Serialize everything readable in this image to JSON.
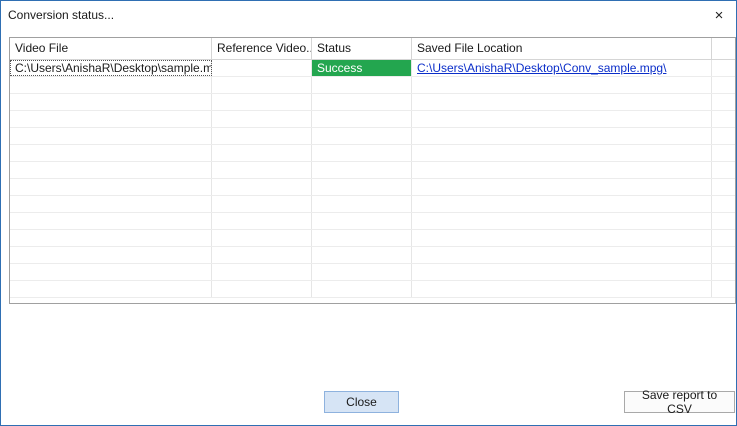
{
  "window": {
    "title": "Conversion status...",
    "close_glyph": "×"
  },
  "table": {
    "columns": [
      "Video File",
      "Reference Video...",
      "Status",
      "Saved File Location"
    ],
    "rows": [
      {
        "video_file": "C:\\Users\\AnishaR\\Desktop\\sample.mpg",
        "reference_video": "",
        "status": "Success",
        "saved_location": "C:\\Users\\AnishaR\\Desktop\\Conv_sample.mpg\\"
      }
    ],
    "status_color": "#23a64f",
    "link_color": "#0b2ec9"
  },
  "buttons": {
    "close_label": "Close",
    "save_csv_label": "Save report to CSV"
  }
}
